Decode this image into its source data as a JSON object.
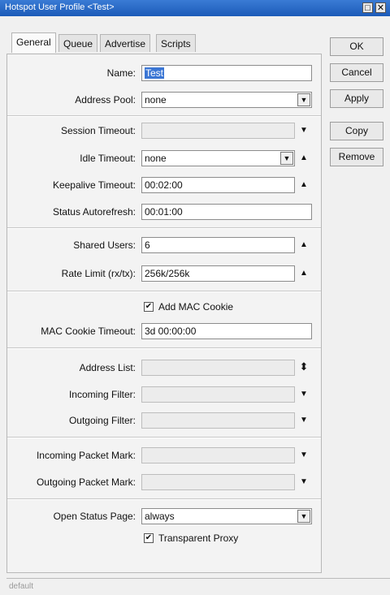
{
  "window": {
    "title": "Hotspot User Profile <Test>",
    "controls": {
      "maximize": "□",
      "close": "✕"
    }
  },
  "tabs": [
    {
      "label": "General",
      "active": true
    },
    {
      "label": "Queue",
      "active": false
    },
    {
      "label": "Advertise",
      "active": false
    },
    {
      "label": "Scripts",
      "active": false
    }
  ],
  "buttons": {
    "ok": "OK",
    "cancel": "Cancel",
    "apply": "Apply",
    "copy": "Copy",
    "remove": "Remove"
  },
  "fields": {
    "name": {
      "label": "Name:",
      "value": "Test"
    },
    "address_pool": {
      "label": "Address Pool:",
      "value": "none"
    },
    "session_timeout": {
      "label": "Session Timeout:",
      "value": ""
    },
    "idle_timeout": {
      "label": "Idle Timeout:",
      "value": "none"
    },
    "keepalive_timeout": {
      "label": "Keepalive Timeout:",
      "value": "00:02:00"
    },
    "status_autorefresh": {
      "label": "Status Autorefresh:",
      "value": "00:01:00"
    },
    "shared_users": {
      "label": "Shared Users:",
      "value": "6"
    },
    "rate_limit": {
      "label": "Rate Limit (rx/tx):",
      "value": "256k/256k"
    },
    "mac_cookie_timeout": {
      "label": "MAC Cookie Timeout:",
      "value": "3d 00:00:00"
    },
    "address_list": {
      "label": "Address List:",
      "value": ""
    },
    "incoming_filter": {
      "label": "Incoming Filter:",
      "value": ""
    },
    "outgoing_filter": {
      "label": "Outgoing Filter:",
      "value": ""
    },
    "incoming_packet_mark": {
      "label": "Incoming Packet Mark:",
      "value": ""
    },
    "outgoing_packet_mark": {
      "label": "Outgoing Packet Mark:",
      "value": ""
    },
    "open_status_page": {
      "label": "Open Status Page:",
      "value": "always"
    }
  },
  "checkboxes": {
    "add_mac_cookie": {
      "label": "Add MAC Cookie",
      "checked": true,
      "mark": "✔"
    },
    "transparent_proxy": {
      "label": "Transparent Proxy",
      "checked": true,
      "mark": "✔"
    }
  },
  "glyphs": {
    "dropdown": "▼",
    "arrow_down": "▼",
    "arrow_up": "▲",
    "updown": "⬍"
  },
  "status_bar": {
    "text": "default"
  },
  "colors": {
    "titlebar": "#1c5bb8",
    "selection": "#3b76d4"
  }
}
